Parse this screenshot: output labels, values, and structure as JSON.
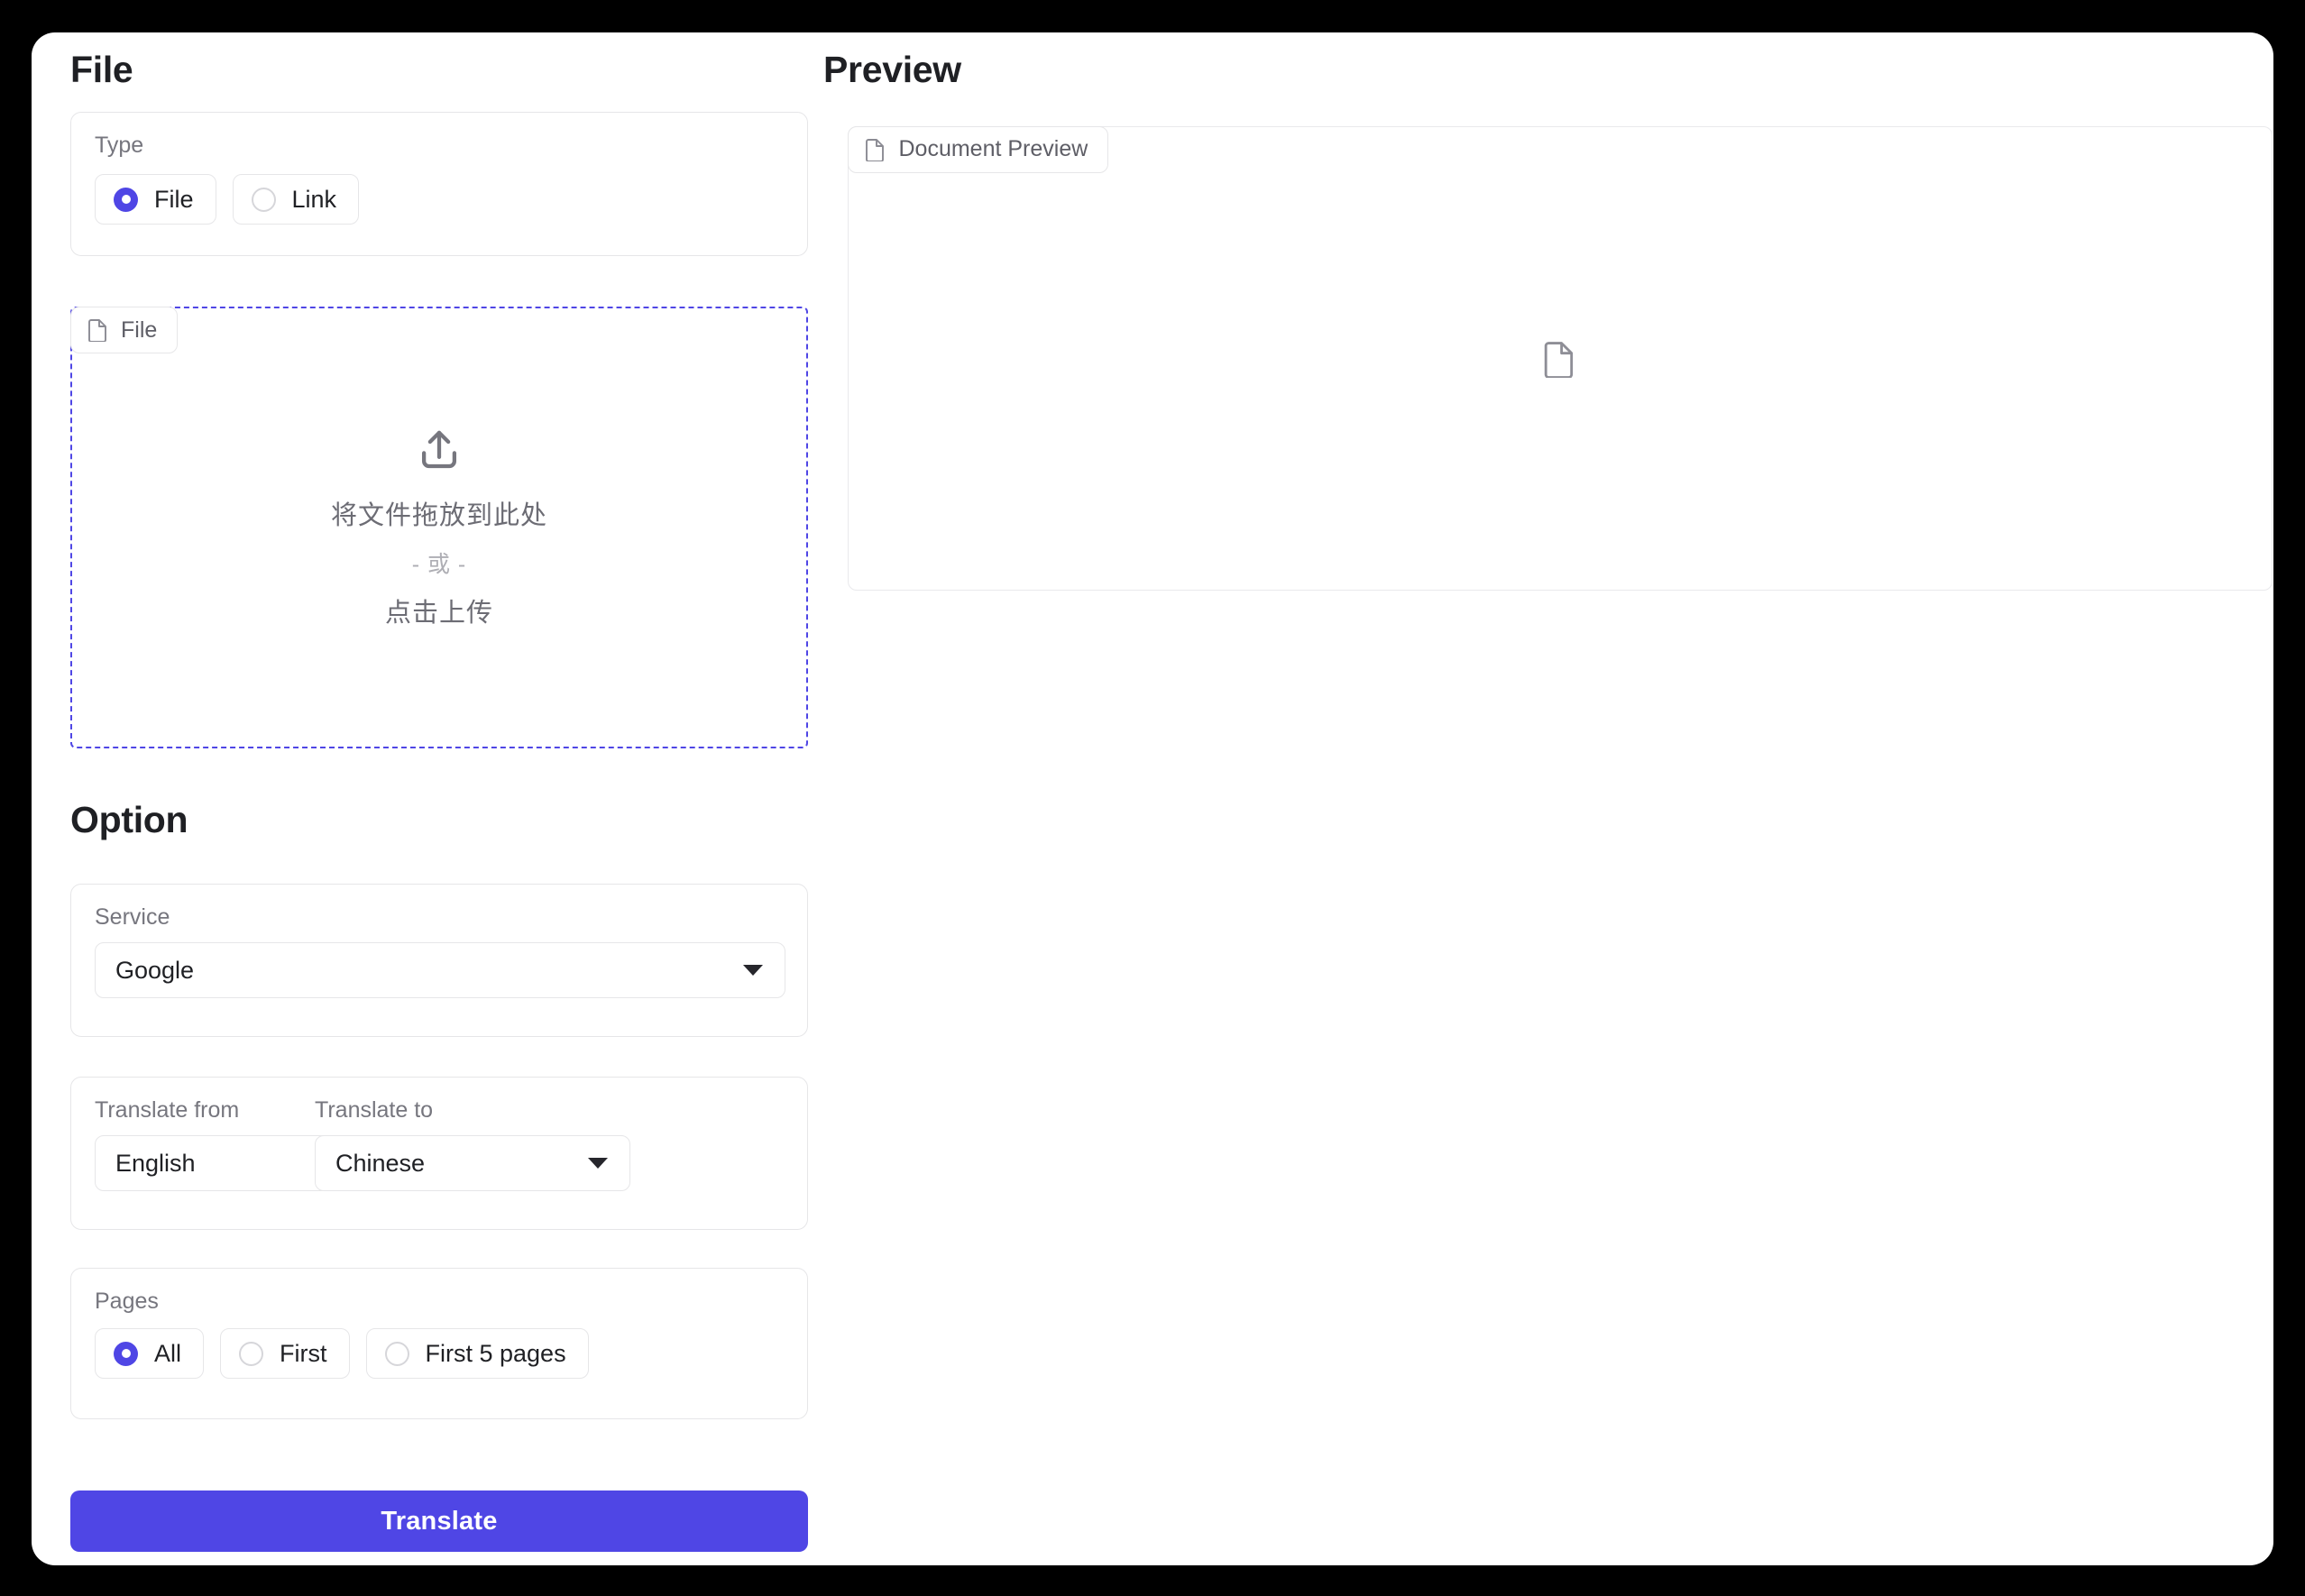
{
  "colors": {
    "accent": "#4f46e5",
    "page_background": "#000000",
    "card_background": "#ffffff",
    "border": "#e6e6e8",
    "muted_text": "#76767e",
    "body_text": "#1f2024"
  },
  "left_panel": {
    "title": "File",
    "type_group": {
      "label": "Type",
      "options": [
        {
          "label": "File",
          "selected": true
        },
        {
          "label": "Link",
          "selected": false
        }
      ]
    },
    "dropzone": {
      "tab_label": "File",
      "tab_icon": "document-icon",
      "upload_icon": "upload-icon",
      "drag_text": "将文件拖放到此处",
      "or_text": "- 或 -",
      "click_text": "点击上传"
    }
  },
  "option_panel": {
    "title": "Option",
    "service": {
      "label": "Service",
      "value": "Google"
    },
    "translate_from": {
      "label": "Translate from",
      "value": "English"
    },
    "translate_to": {
      "label": "Translate to",
      "value": "Chinese"
    },
    "pages": {
      "label": "Pages",
      "options": [
        {
          "label": "All",
          "selected": true
        },
        {
          "label": "First",
          "selected": false
        },
        {
          "label": "First 5 pages",
          "selected": false
        }
      ]
    },
    "submit_button": "Translate"
  },
  "preview_panel": {
    "title": "Preview",
    "tab_label": "Document Preview",
    "tab_icon": "document-icon",
    "empty_icon": "document-icon"
  }
}
